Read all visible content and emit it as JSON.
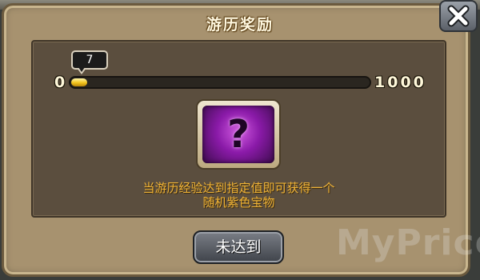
{
  "dialog": {
    "title": "游历奖励",
    "close_icon": "close-x-icon"
  },
  "progress": {
    "current": "7",
    "min_label": "0",
    "max_label": "1000",
    "fraction": 0.007,
    "fill_color": "#f2c21a"
  },
  "reward": {
    "icon": "question-mark-mystery-item-icon",
    "description_line1": "当游历经验达到指定值即可获得一个",
    "description_line2": "随机紫色宝物",
    "text_color": "#f0b437"
  },
  "action": {
    "button_label": "未达到"
  },
  "watermark": {
    "text": "MyPrice"
  }
}
